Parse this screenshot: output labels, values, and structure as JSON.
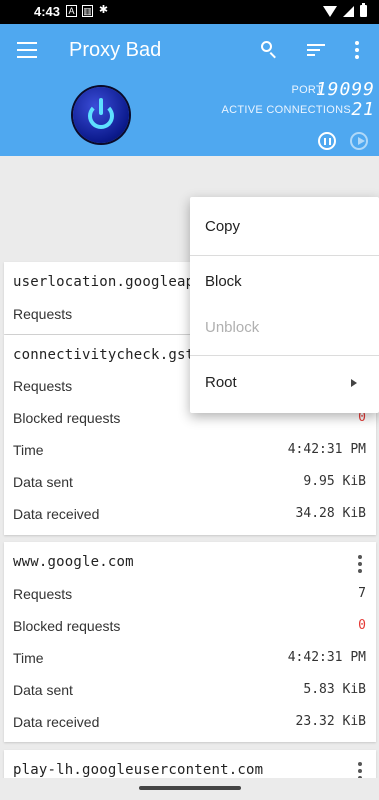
{
  "status_bar": {
    "time": "4:43",
    "icons": [
      "a-notification-icon",
      "usb-icon",
      "android-debug-icon"
    ],
    "right_icons": [
      "wifi-icon",
      "signal-icon",
      "battery-icon"
    ]
  },
  "app_bar": {
    "title": "Proxy Bad",
    "port_label": "PORT",
    "port_value": "19099",
    "active_connections_label": "ACTIVE CONNECTIONS",
    "active_connections_value": "21",
    "accent_color": "#4fa8f0"
  },
  "context_menu": {
    "items": [
      {
        "label": "Copy",
        "enabled": true
      },
      {
        "label": "Block",
        "enabled": true
      },
      {
        "label": "Unblock",
        "enabled": false
      },
      {
        "label": "Root",
        "enabled": true,
        "has_submenu": true
      }
    ]
  },
  "cards": [
    {
      "host": "userlocation.googleapis.com",
      "rows": [
        {
          "label": "Requests",
          "value": ""
        }
      ]
    },
    {
      "host": "connectivitycheck.gstatic.com",
      "rows": [
        {
          "label": "Requests",
          "value": ""
        },
        {
          "label": "Blocked requests",
          "value": "0"
        },
        {
          "label": "Time",
          "value": "4:42:31 PM"
        },
        {
          "label": "Data sent",
          "value": "9.95 KiB"
        },
        {
          "label": "Data received",
          "value": "34.28 KiB"
        }
      ]
    },
    {
      "host": "www.google.com",
      "rows": [
        {
          "label": "Requests",
          "value": "7"
        },
        {
          "label": "Blocked requests",
          "value": "0"
        },
        {
          "label": "Time",
          "value": "4:42:31 PM"
        },
        {
          "label": "Data sent",
          "value": "5.83 KiB"
        },
        {
          "label": "Data received",
          "value": "23.32 KiB"
        }
      ]
    },
    {
      "host": "play-lh.googleusercontent.com",
      "rows": []
    }
  ],
  "colors": {
    "blocked_value": "#e53935",
    "power_glow": "#5ee0ff"
  }
}
